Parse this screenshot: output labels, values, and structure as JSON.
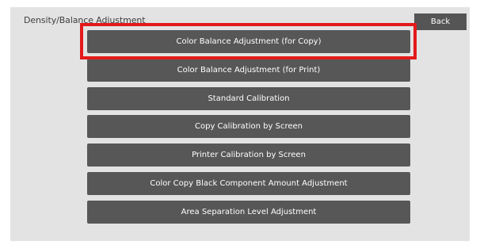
{
  "header": {
    "title": "Density/Balance Adjustment",
    "back_label": "Back"
  },
  "menu": {
    "items": [
      {
        "label": "Color Balance Adjustment (for Copy)"
      },
      {
        "label": "Color Balance Adjustment (for Print)"
      },
      {
        "label": "Standard Calibration"
      },
      {
        "label": "Copy Calibration by Screen"
      },
      {
        "label": "Printer Calibration by Screen"
      },
      {
        "label": "Color Copy Black Component Amount Adjustment"
      },
      {
        "label": "Area Separation Level Adjustment"
      }
    ]
  },
  "colors": {
    "panel_background": "#e3e3e3",
    "button_background": "#575757",
    "button_text": "#ffffff",
    "highlight_border": "#e41a1a"
  },
  "highlight": {
    "target": "Color Balance Adjustment (for Copy)"
  }
}
